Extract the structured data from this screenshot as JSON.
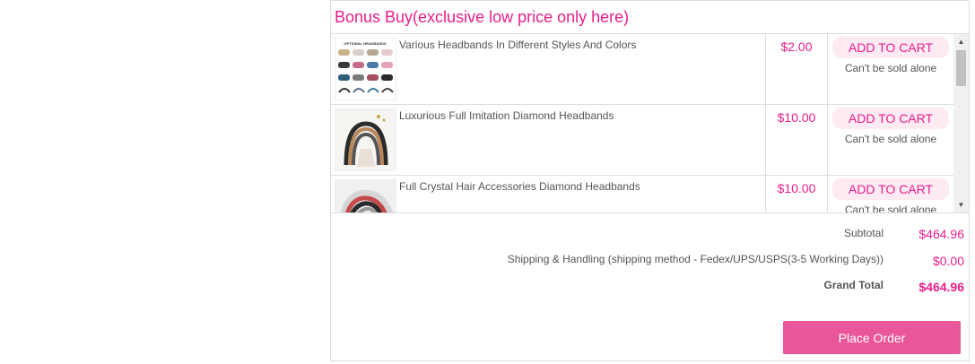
{
  "bonus": {
    "title": "Bonus Buy(exclusive low price only here)",
    "items": [
      {
        "name": "Various Headbands In Different Styles And Colors",
        "price": "$2.00",
        "button": "ADD TO CART",
        "note": "Can't be sold alone",
        "thumb_caption": "OPTIONAL HEADBANDS"
      },
      {
        "name": "Luxurious Full Imitation Diamond Headbands",
        "price": "$10.00",
        "button": "ADD TO CART",
        "note": "Can't be sold alone"
      },
      {
        "name": "Full Crystal Hair Accessories Diamond Headbands",
        "price": "$10.00",
        "button": "ADD TO CART",
        "note": "Can't be sold alone"
      }
    ]
  },
  "totals": {
    "subtotal_label": "Subtotal",
    "subtotal_value": "$464.96",
    "shipping_label": "Shipping & Handling (shipping method - Fedex/UPS/USPS(3-5 Working Days))",
    "shipping_value": "$0.00",
    "grand_label": "Grand Total",
    "grand_value": "$464.96"
  },
  "actions": {
    "place_order": "Place Order"
  },
  "colors": {
    "accent": "#e91e8c",
    "button_bg": "#e9579a",
    "cart_bg": "#fdeaf2"
  }
}
